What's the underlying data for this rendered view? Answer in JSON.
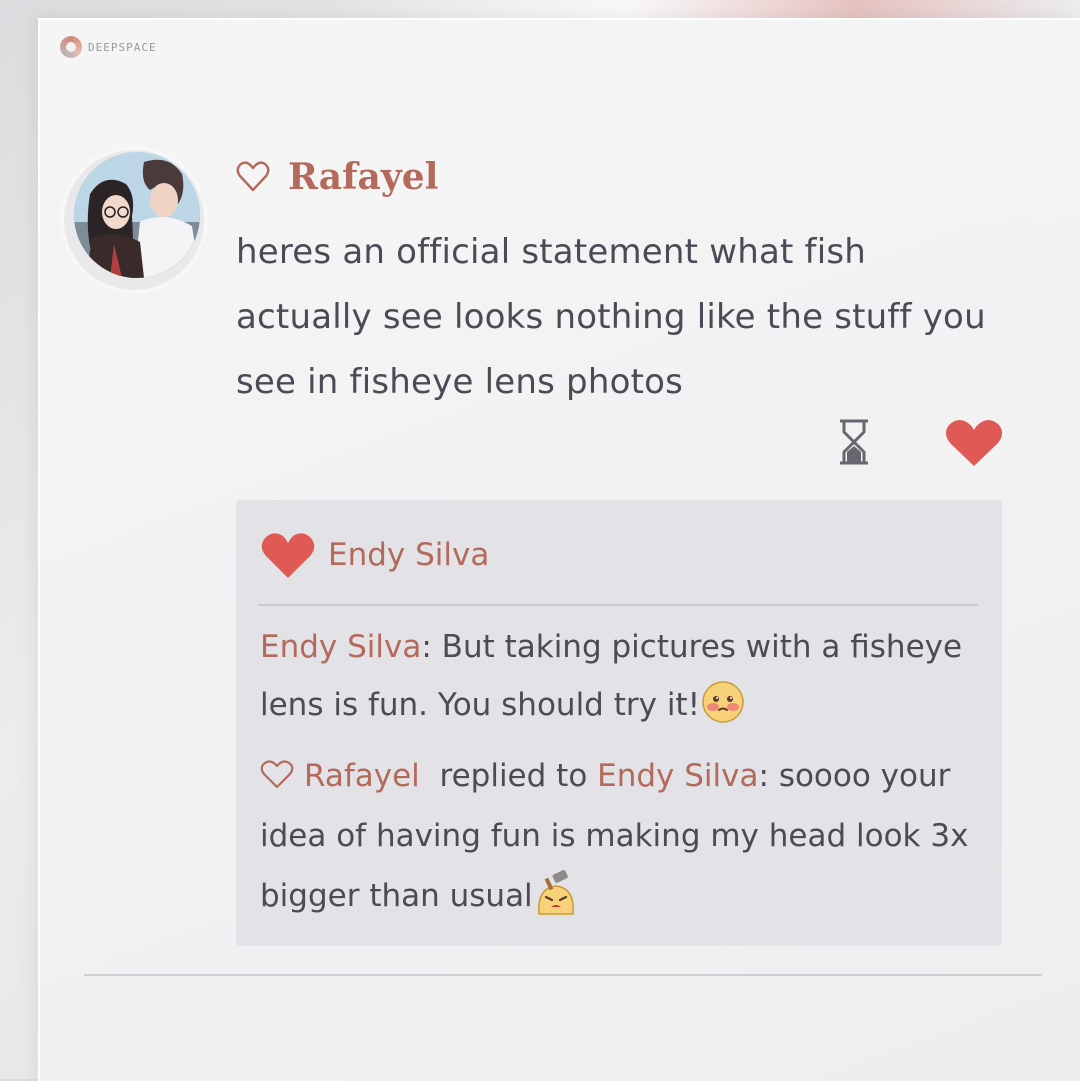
{
  "brand": {
    "name": "DEEPSPACE"
  },
  "post": {
    "author": "Rafayel",
    "text": "heres an official statement what fish actually see looks nothing like the stuff you see in fisheye lens photos",
    "author_avatar_icon": "avatar-couple",
    "status_icon": "hourglass-icon",
    "like_icon": "heart-icon"
  },
  "likes": {
    "names": "Endy Silva"
  },
  "comments": [
    {
      "author": "Endy Silva",
      "separator": ": ",
      "text": "But taking pictures with a fisheye lens is fun. You should try it!",
      "emoji": "blush-emoji"
    },
    {
      "author": "Rafayel",
      "replied_label": "replied to",
      "reply_to": "Endy Silva",
      "separator": ": ",
      "text": "soooo your idea of having fun is making my head look 3x bigger than usual",
      "emoji": "angry-bonk-emoji"
    }
  ],
  "colors": {
    "accent": "#b46a5b",
    "heart": "#e05a55",
    "text": "#4e4a55",
    "panel": "#f2f2f3"
  }
}
